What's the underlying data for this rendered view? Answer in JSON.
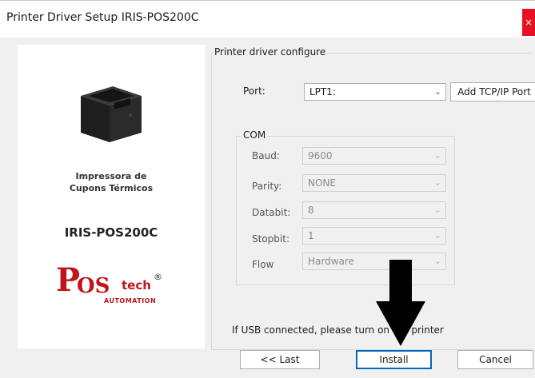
{
  "window": {
    "title": "Printer Driver Setup IRIS-POS200C",
    "close_label": "×"
  },
  "left_panel": {
    "brand_line1": "Impressora de",
    "brand_line2": "Cupons Térmicos",
    "model": "IRIS-POS200C",
    "logo": {
      "main": "POS",
      "tech": "tech",
      "reg": "®",
      "sub": "AUTOMATION"
    }
  },
  "config": {
    "legend": "Printer driver configure",
    "port_label": "Port:",
    "port_value": "LPT1:",
    "add_tcp_label": "Add TCP/IP Port",
    "com": {
      "legend": "COM",
      "baud_label": "Baud:",
      "baud_value": "9600",
      "parity_label": "Parity:",
      "parity_value": "NONE",
      "databit_label": "Databit:",
      "databit_value": "8",
      "stopbit_label": "Stopbit:",
      "stopbit_value": "1",
      "flow_label": "Flow",
      "flow_value": "Hardware"
    },
    "usb_note": "If USB connected, please turn on the printer"
  },
  "buttons": {
    "last": "<< Last",
    "install": "Install",
    "cancel": "Cancel"
  },
  "colors": {
    "close": "#e81123",
    "logo_red": "#c0151b",
    "focus": "#0067c0"
  }
}
